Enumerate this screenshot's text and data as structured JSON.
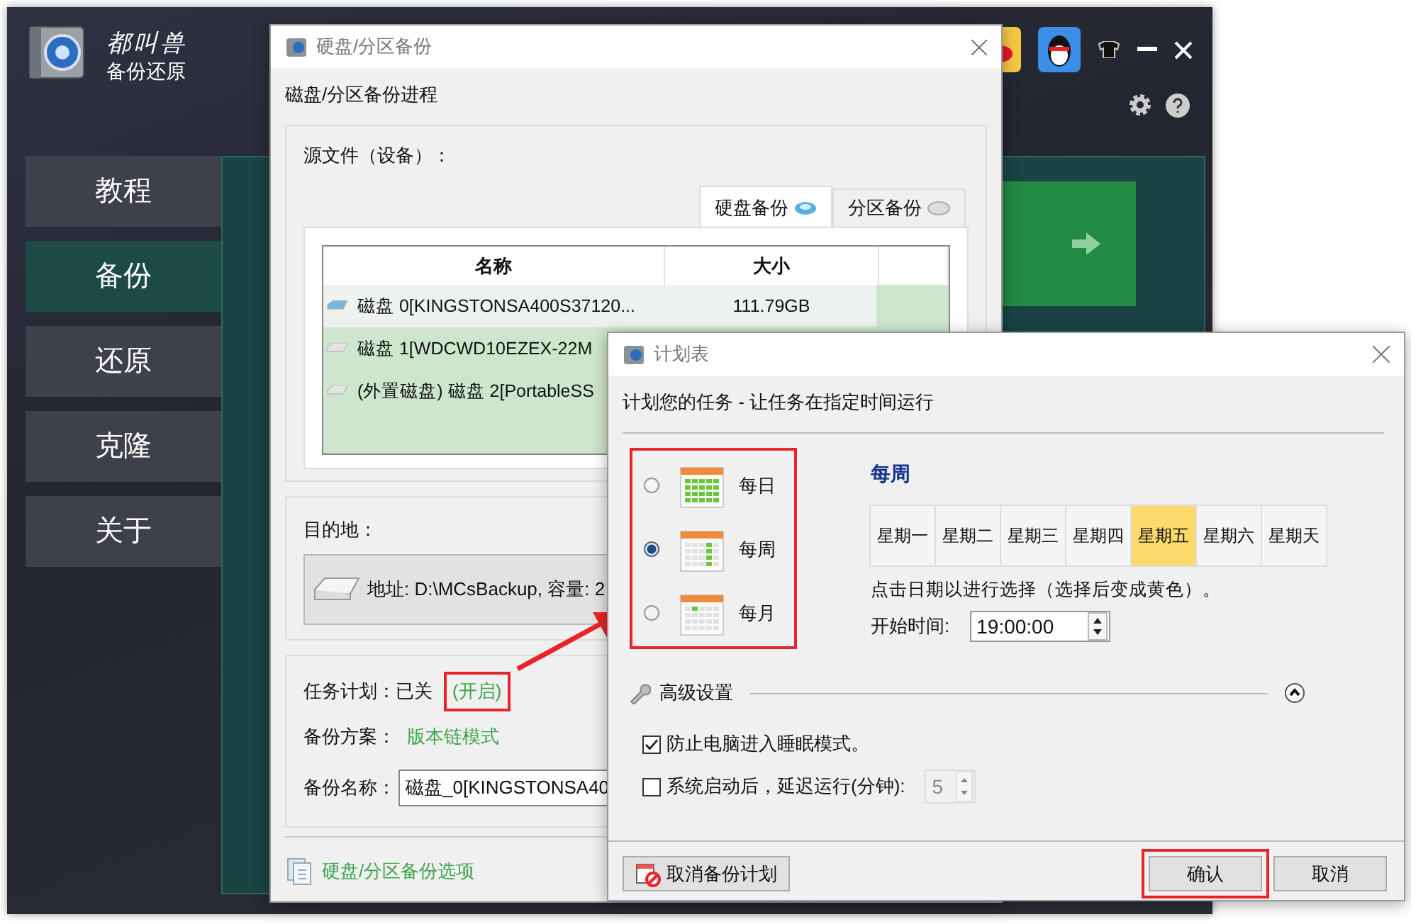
{
  "app": {
    "brand": "都叫兽",
    "subtitle": "备份还原",
    "nav": [
      {
        "label": "教程",
        "selected": false
      },
      {
        "label": "备份",
        "selected": true
      },
      {
        "label": "还原",
        "selected": false
      },
      {
        "label": "克隆",
        "selected": false
      },
      {
        "label": "关于",
        "selected": false
      }
    ]
  },
  "backup_dialog": {
    "title": "硬盘/分区备份",
    "heading": "磁盘/分区备份进程",
    "source_label": "源文件（设备）：",
    "tabs": [
      {
        "label": "硬盘备份",
        "selected": true
      },
      {
        "label": "分区备份",
        "selected": false
      }
    ],
    "table": {
      "columns": [
        "名称",
        "大小"
      ],
      "rows": [
        {
          "name": "磁盘 0[KINGSTONSA400S37120...",
          "size": "111.79GB",
          "selected": true
        },
        {
          "name": "磁盘 1[WDCWD10EZEX-22M",
          "selected": false
        },
        {
          "name": "(外置磁盘) 磁盘 2[PortableSS",
          "selected": false
        }
      ]
    },
    "destination_label": "目的地：",
    "destination": "地址: D:\\MCsBackup, 容量: 2",
    "schedule_label": "任务计划：已关",
    "schedule_link": "(开启)",
    "schedule_link_highlighted": true,
    "scheme_label": "备份方案：",
    "scheme_link": "版本链模式",
    "name_label": "备份名称：",
    "name_value": "磁盘_0[KINGSTONSA40",
    "options_link": "硬盘/分区备份选项"
  },
  "schedule_dialog": {
    "title": "计划表",
    "heading": "计划您的任务 - 让任务在指定时间运行",
    "frequencies_highlighted": true,
    "frequencies": [
      {
        "label": "每日",
        "selected": false
      },
      {
        "label": "每周",
        "selected": true
      },
      {
        "label": "每月",
        "selected": false
      }
    ],
    "mode_title": "每周",
    "days": [
      {
        "label": "星期一",
        "selected": false
      },
      {
        "label": "星期二",
        "selected": false
      },
      {
        "label": "星期三",
        "selected": false
      },
      {
        "label": "星期四",
        "selected": false
      },
      {
        "label": "星期五",
        "selected": true
      },
      {
        "label": "星期六",
        "selected": false
      },
      {
        "label": "星期天",
        "selected": false
      }
    ],
    "hint": "点击日期以进行选择（选择后变成黄色）。",
    "start_label": "开始时间:",
    "start_time": "19:00:00",
    "advanced_label": "高级设置",
    "advanced_expanded": true,
    "options": [
      {
        "label": "防止电脑进入睡眠模式。",
        "checked": true
      },
      {
        "label": "系统启动后，延迟运行(分钟):",
        "checked": false
      }
    ],
    "delay_value": "5",
    "buttons": [
      {
        "label": "取消备份计划",
        "kind": "cancel-plan",
        "highlighted": false
      },
      {
        "label": "确认",
        "kind": "confirm",
        "highlighted": true
      },
      {
        "label": "取消",
        "kind": "cancel",
        "highlighted": false
      }
    ]
  }
}
